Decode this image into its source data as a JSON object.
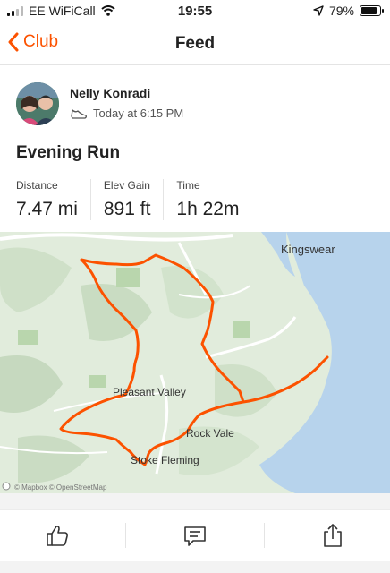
{
  "status": {
    "carrier": "EE WiFiCall",
    "time": "19:55",
    "battery_text": "79%",
    "battery_level": 0.79
  },
  "nav": {
    "back_label": "Club",
    "title": "Feed"
  },
  "activity": {
    "athlete_name": "Nelly Konradi",
    "timestamp": "Today at 6:15 PM",
    "title": "Evening Run",
    "stats": [
      {
        "label": "Distance",
        "value": "7.47 mi"
      },
      {
        "label": "Elev Gain",
        "value": "891 ft"
      },
      {
        "label": "Time",
        "value": "1h 22m"
      }
    ]
  },
  "map": {
    "places": {
      "kingswear": "Kingswear",
      "pleasant_valley": "Pleasant Valley",
      "rock_vale": "Rock Vale",
      "stoke_fleming": "Stoke Fleming"
    },
    "attribution": "© Mapbox © OpenStreetMap",
    "route_color": "#fc5200",
    "sea_color": "#b7d3ec",
    "land_color": "#e1ecdc"
  },
  "actions": {
    "kudos": "thumbs-up-icon",
    "comment": "comment-icon",
    "share": "share-icon"
  },
  "colors": {
    "accent": "#fc5200"
  }
}
